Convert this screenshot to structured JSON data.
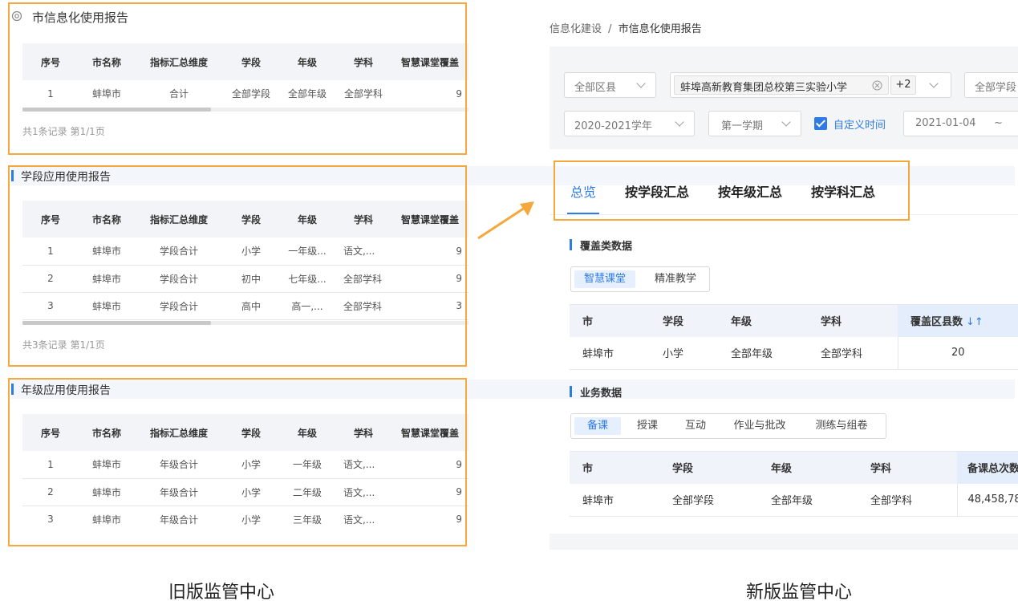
{
  "old": {
    "panel1": {
      "title": "市信息化使用报告",
      "columns": [
        "序号",
        "市名称",
        "指标汇总维度",
        "学段",
        "年级",
        "学科",
        "智慧课堂覆盖"
      ],
      "rows": [
        [
          "1",
          "蚌埠市",
          "合计",
          "全部学段",
          "全部年级",
          "全部学科",
          "9"
        ]
      ],
      "footer": "共1条记录 第1/1页"
    },
    "panel2": {
      "title": "学段应用使用报告",
      "columns": [
        "序号",
        "市名称",
        "指标汇总维度",
        "学段",
        "年级",
        "学科",
        "智慧课堂覆盖"
      ],
      "rows": [
        [
          "1",
          "蚌埠市",
          "学段合计",
          "小学",
          "一年级...",
          "语文,...",
          "9"
        ],
        [
          "2",
          "蚌埠市",
          "学段合计",
          "初中",
          "七年级...",
          "全部学科",
          "9"
        ],
        [
          "3",
          "蚌埠市",
          "学段合计",
          "高中",
          "高一,...",
          "全部学科",
          "3"
        ]
      ],
      "footer": "共3条记录 第1/1页"
    },
    "panel3": {
      "title": "年级应用使用报告",
      "columns": [
        "序号",
        "市名称",
        "指标汇总维度",
        "学段",
        "年级",
        "学科",
        "智慧课堂覆盖"
      ],
      "rows": [
        [
          "1",
          "蚌埠市",
          "年级合计",
          "小学",
          "一年级",
          "语文,...",
          "9"
        ],
        [
          "2",
          "蚌埠市",
          "年级合计",
          "小学",
          "二年级",
          "语文,...",
          "9"
        ],
        [
          "3",
          "蚌埠市",
          "年级合计",
          "小学",
          "三年级",
          "语文,...",
          "9"
        ]
      ]
    },
    "caption": "旧版监管中心"
  },
  "new": {
    "breadcrumb": {
      "parent": "信息化建设",
      "sep": "/",
      "current": "市信息化使用报告"
    },
    "filters": {
      "district": "全部区县",
      "school": "蚌埠高新教育集团总校第三实验小学",
      "more_count": "+2",
      "stage": "全部学段",
      "year": "2020-2021学年",
      "term": "第一学期",
      "custom_time_label": "自定义时间",
      "date_start": "2021-01-04",
      "date_sep": "~"
    },
    "tabs": [
      "总览",
      "按学段汇总",
      "按年级汇总",
      "按学科汇总"
    ],
    "coverage": {
      "title": "覆盖类数据",
      "segments": [
        "智慧课堂",
        "精准教学"
      ],
      "columns": [
        "市",
        "学段",
        "年级",
        "学科",
        "覆盖区县数"
      ],
      "sort_icon": "↓↑",
      "row": [
        "蚌埠市",
        "小学",
        "全部年级",
        "全部学科",
        "20"
      ]
    },
    "business": {
      "title": "业务数据",
      "segments": [
        "备课",
        "授课",
        "互动",
        "作业与批改",
        "测练与组卷"
      ],
      "columns": [
        "市",
        "学段",
        "年级",
        "学科",
        "备课总次数"
      ],
      "row": [
        "蚌埠市",
        "全部学段",
        "全部年级",
        "全部学科",
        "48,458,78"
      ]
    },
    "caption": "新版监管中心"
  },
  "colors": {
    "highlight_box": "#f5a83c",
    "accent": "#2f7be6"
  }
}
